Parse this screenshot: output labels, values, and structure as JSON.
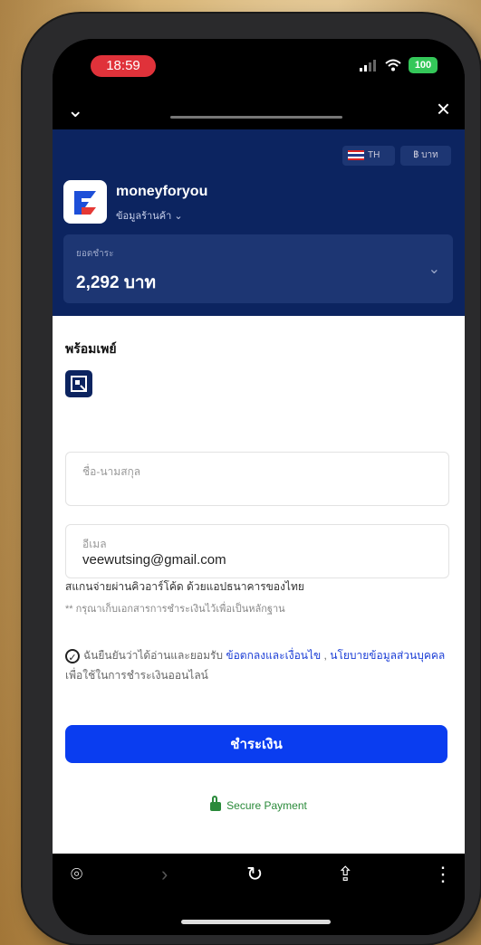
{
  "status": {
    "time": "18:59",
    "battery": "100"
  },
  "header": {
    "lang_label": "TH",
    "currency_label": "฿ บาท",
    "merchant_name": "moneyforyou",
    "merchant_sub": "ข้อมูลร้านค้า",
    "amount_label": "ยอดชำระ",
    "amount": "2,292 บาท"
  },
  "form": {
    "section_title": "พร้อมเพย์",
    "name_label": "ชื่อ-นามสกุล",
    "email_label": "อีเมล",
    "email_value": "veewutsing@gmail.com",
    "note1": "สแกนจ่ายผ่านคิวอาร์โค้ด ด้วยแอปธนาคารของไทย",
    "note2": "** กรุณาเก็บเอกสารการชำระเงินไว้เพื่อเป็นหลักฐาน",
    "consent_text": "ฉันยืนยันว่าได้อ่านและยอมรับ",
    "consent_link1": "ข้อตกลงและเงื่อนไข",
    "consent_sep": " , ",
    "consent_link2": "นโยบายข้อมูลส่วนบุคคล",
    "consent_tail": " เพื่อใช้ในการชำระเงินออนไลน์",
    "pay_label": "ชำระเงิน",
    "secure_label": "Secure Payment"
  },
  "icons": {
    "close": "close-icon",
    "back": "chevron-down-icon",
    "qr": "qr-scan-icon",
    "lock": "lock-icon"
  },
  "colors": {
    "header_bg": "#0c2460",
    "pay_button": "#0a3df0",
    "link": "#1d3fd6",
    "secure": "#2a8a3a"
  }
}
